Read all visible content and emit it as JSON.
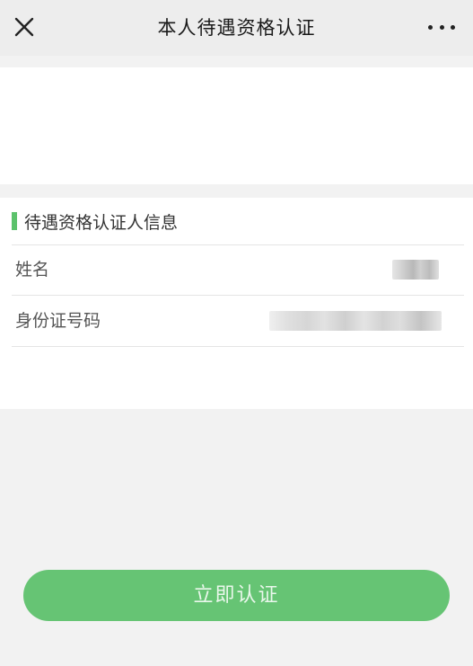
{
  "navbar": {
    "title": "本人待遇资格认证",
    "close_icon": "close-icon",
    "more_icon": "more-icon"
  },
  "section": {
    "title": "待遇资格认证人信息",
    "accent_color": "#5cc26c"
  },
  "fields": {
    "name_label": "姓名",
    "id_label": "身份证号码"
  },
  "button": {
    "label": "立即认证",
    "color": "#66c474"
  }
}
